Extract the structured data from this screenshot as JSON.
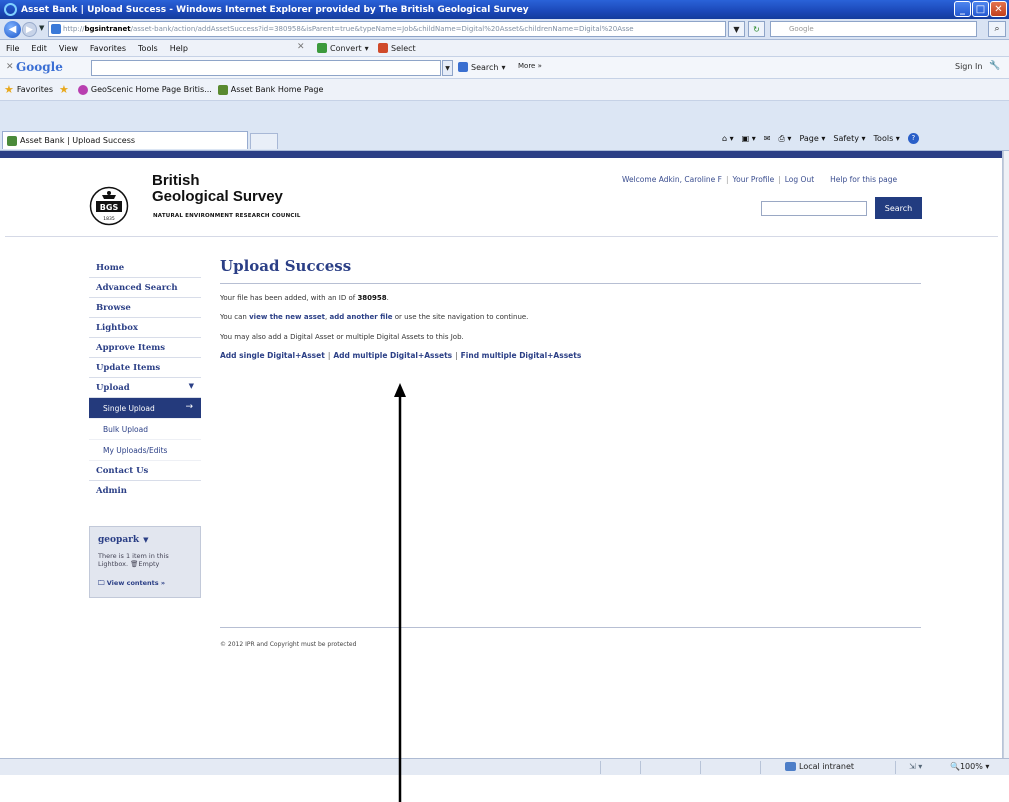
{
  "window": {
    "title": "Asset Bank | Upload Success - Windows Internet Explorer provided by The British Geological Survey"
  },
  "address_bar": {
    "url_prefix": "http://",
    "url_host": "bgsintranet",
    "url_rest": "/asset-bank/action/addAssetSuccess?id=380958&isParent=true&typeName=Job&childName=Digital%20Asset&childrenName=Digital%20Asse",
    "search_placeholder": "Google"
  },
  "menu": {
    "items": [
      "File",
      "Edit",
      "View",
      "Favorites",
      "Tools",
      "Help"
    ],
    "convert_label": "Convert",
    "select_label": "Select"
  },
  "google_toolbar": {
    "logo": "Google",
    "search_label": "Search",
    "more_label": "More »",
    "sign_in_label": "Sign In"
  },
  "favorites_bar": {
    "favorites_label": "Favorites",
    "items": [
      "GeoScenic Home Page Britis...",
      "Asset Bank Home Page"
    ]
  },
  "tabs": {
    "active_tab": "Asset Bank | Upload Success"
  },
  "command_bar": {
    "page_label": "Page",
    "safety_label": "Safety",
    "tools_label": "Tools"
  },
  "header": {
    "brand_line1": "British",
    "brand_line2": "Geological Survey",
    "brand_line3": "NATURAL ENVIRONMENT RESEARCH COUNCIL",
    "logo_year": "1835",
    "welcome": "Welcome Adkin, Caroline F",
    "profile_link": "Your Profile",
    "logout_link": "Log Out",
    "help_link": "Help for this page",
    "search_button": "Search"
  },
  "nav": {
    "home": "Home",
    "advanced_search": "Advanced Search",
    "browse": "Browse",
    "lightbox": "Lightbox",
    "approve_items": "Approve Items",
    "update_items": "Update Items",
    "upload": "Upload",
    "single_upload": "Single Upload",
    "bulk_upload": "Bulk Upload",
    "my_uploads": "My Uploads/Edits",
    "contact_us": "Contact Us",
    "admin": "Admin"
  },
  "lightbox_panel": {
    "name": "geopark",
    "info_line1": "There is 1 item in this",
    "info_line2": "Lightbox.",
    "empty_label": "Empty",
    "view_contents": "View contents »"
  },
  "main": {
    "title": "Upload Success",
    "p1_text": "Your file has been added, with an ID of",
    "asset_id": "380958",
    "p1_end": ".",
    "p2_prefix": "You can",
    "p2_link1": "view the new asset",
    "p2_comma": ",",
    "p2_link2": "add another file",
    "p2_suffix": "or use the site navigation to continue.",
    "p3_text": "You may also add a Digital Asset or multiple Digital Assets to this Job.",
    "action_links": [
      "Add single Digital+Asset",
      "Add multiple Digital+Assets",
      "Find multiple Digital+Assets"
    ],
    "separator": "|"
  },
  "footer": {
    "text": "© 2012 IPR and Copyright must be protected"
  },
  "status_bar": {
    "zone": "Local intranet",
    "zoom": "100%"
  },
  "colors": {
    "brand_navy": "#2b3f86",
    "active_nav": "#243a7c",
    "titlebar": "#1b48b8"
  }
}
